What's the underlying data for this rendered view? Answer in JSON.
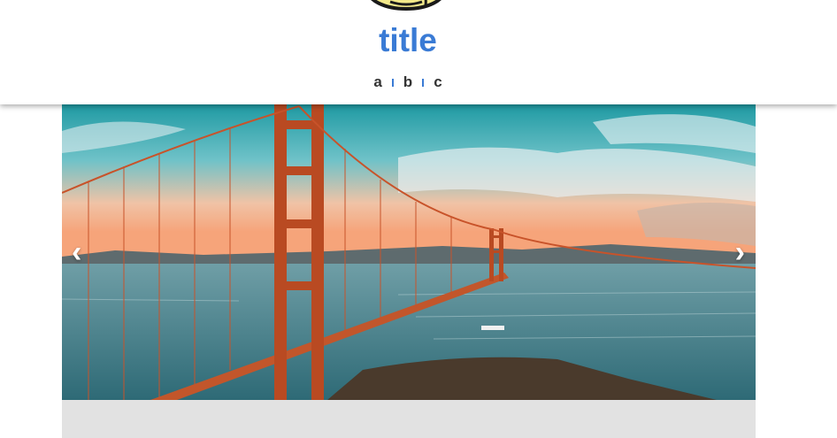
{
  "header": {
    "title": "title",
    "nav_items": [
      "a",
      "b",
      "c"
    ]
  },
  "slider": {
    "prev_icon": "‹",
    "next_icon": "›",
    "image_subject": "golden-gate-bridge-photo"
  },
  "colors": {
    "title": "#3a7bd5",
    "nav_separator": "#3a7bd5",
    "logo_yellow": "#f3e98a",
    "logo_outline": "#1a1a1a",
    "content_panel": "#e2e2e2"
  }
}
